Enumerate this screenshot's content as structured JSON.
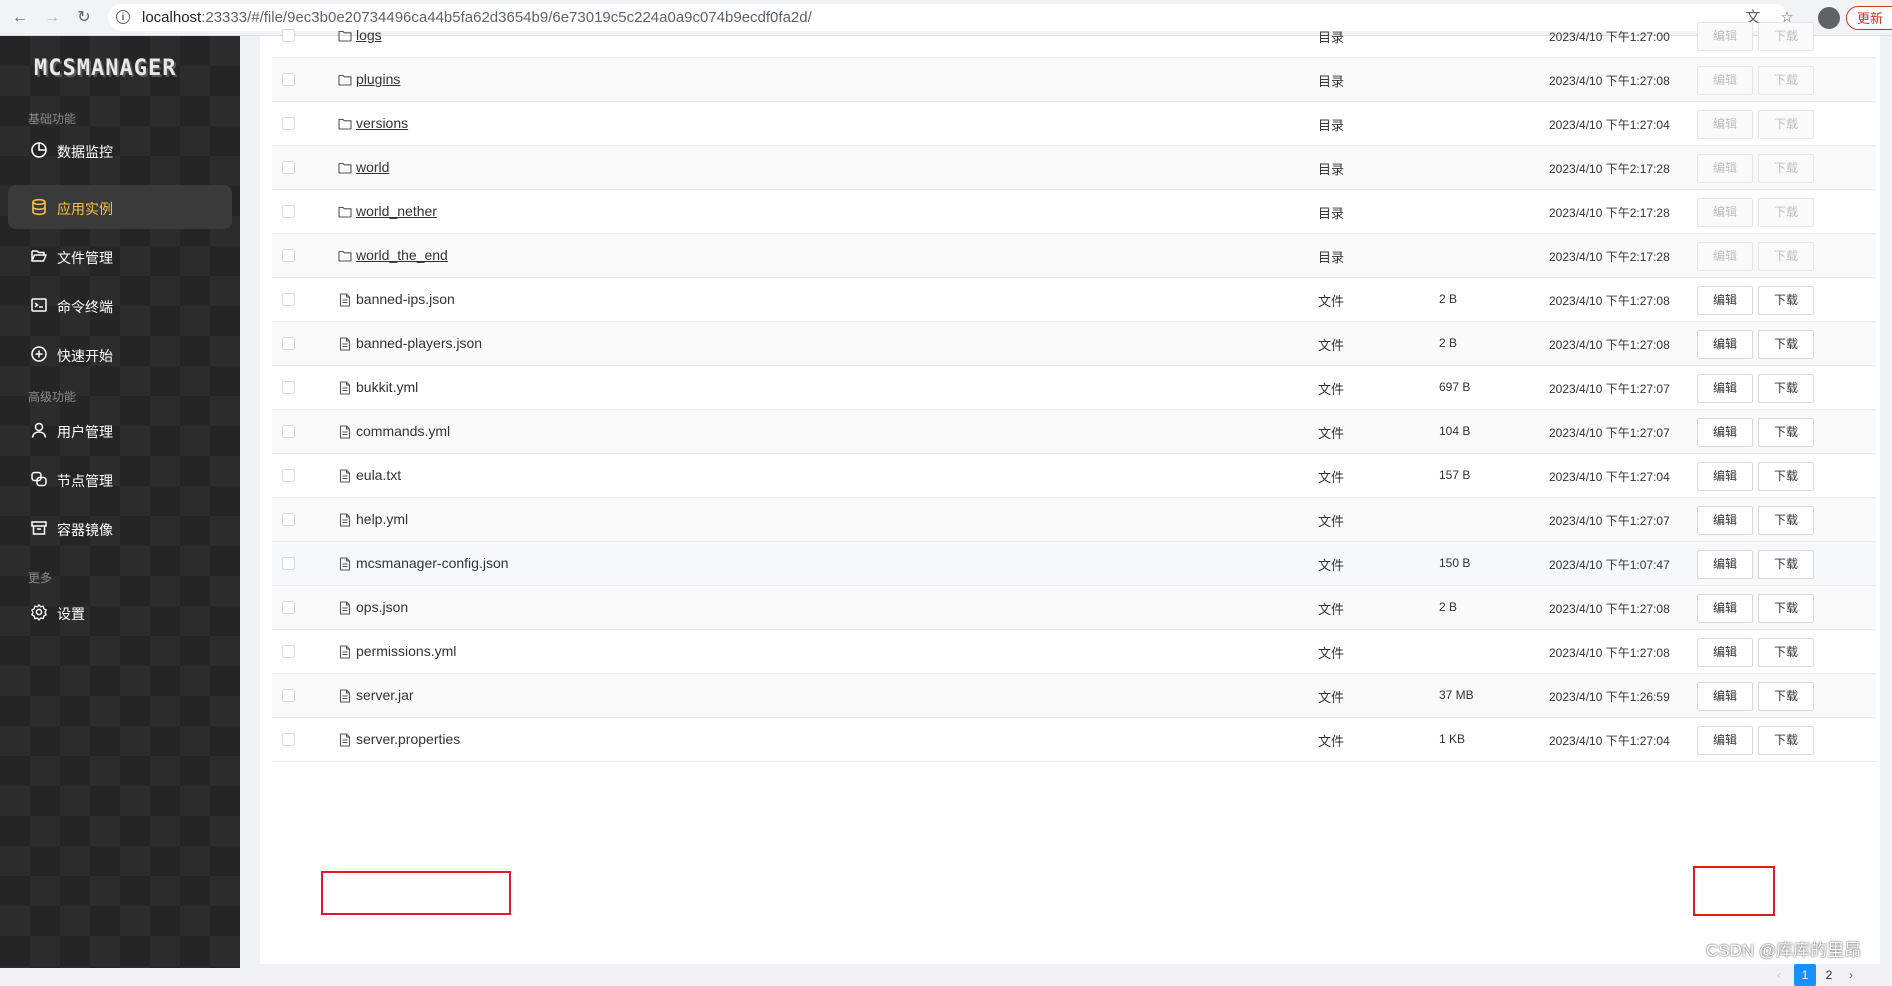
{
  "browser": {
    "url_host": "localhost",
    "url_rest": ":23333/#/file/9ec3b0e20734496ca44b5fa62d3654b9/6e73019c5c224a0a9c074b9ecdf0fa2d/",
    "update_label": "更新"
  },
  "sidebar": {
    "logo": "MCSMANAGER",
    "groups": [
      {
        "title": "基础功能"
      },
      {
        "title": "高级功能"
      },
      {
        "title": "更多"
      }
    ],
    "items": [
      {
        "label": "数据监控",
        "icon": "dashboard-icon"
      },
      {
        "label": "应用实例",
        "icon": "database-icon",
        "active": true
      },
      {
        "label": "文件管理",
        "icon": "folder-open-icon"
      },
      {
        "label": "命令终端",
        "icon": "terminal-icon"
      },
      {
        "label": "快速开始",
        "icon": "plus-circle-icon"
      },
      {
        "label": "用户管理",
        "icon": "user-icon"
      },
      {
        "label": "节点管理",
        "icon": "nodes-icon"
      },
      {
        "label": "容器镜像",
        "icon": "container-icon"
      },
      {
        "label": "设置",
        "icon": "gear-icon"
      }
    ]
  },
  "files": {
    "edit_label": "编辑",
    "download_label": "下载",
    "rows": [
      {
        "name": "logs",
        "type": "目录",
        "size": "",
        "date": "2023/4/10 下午1:27:00",
        "dir": true
      },
      {
        "name": "plugins",
        "type": "目录",
        "size": "",
        "date": "2023/4/10 下午1:27:08",
        "dir": true
      },
      {
        "name": "versions",
        "type": "目录",
        "size": "",
        "date": "2023/4/10 下午1:27:04",
        "dir": true
      },
      {
        "name": "world",
        "type": "目录",
        "size": "",
        "date": "2023/4/10 下午2:17:28",
        "dir": true
      },
      {
        "name": "world_nether",
        "type": "目录",
        "size": "",
        "date": "2023/4/10 下午2:17:28",
        "dir": true
      },
      {
        "name": "world_the_end",
        "type": "目录",
        "size": "",
        "date": "2023/4/10 下午2:17:28",
        "dir": true
      },
      {
        "name": "banned-ips.json",
        "type": "文件",
        "size": "2 B",
        "date": "2023/4/10 下午1:27:08",
        "dir": false
      },
      {
        "name": "banned-players.json",
        "type": "文件",
        "size": "2 B",
        "date": "2023/4/10 下午1:27:08",
        "dir": false
      },
      {
        "name": "bukkit.yml",
        "type": "文件",
        "size": "697 B",
        "date": "2023/4/10 下午1:27:07",
        "dir": false
      },
      {
        "name": "commands.yml",
        "type": "文件",
        "size": "104 B",
        "date": "2023/4/10 下午1:27:07",
        "dir": false
      },
      {
        "name": "eula.txt",
        "type": "文件",
        "size": "157 B",
        "date": "2023/4/10 下午1:27:04",
        "dir": false
      },
      {
        "name": "help.yml",
        "type": "文件",
        "size": "",
        "date": "2023/4/10 下午1:27:07",
        "dir": false
      },
      {
        "name": "mcsmanager-config.json",
        "type": "文件",
        "size": "150 B",
        "date": "2023/4/10 下午1:07:47",
        "dir": false
      },
      {
        "name": "ops.json",
        "type": "文件",
        "size": "2 B",
        "date": "2023/4/10 下午1:27:08",
        "dir": false
      },
      {
        "name": "permissions.yml",
        "type": "文件",
        "size": "",
        "date": "2023/4/10 下午1:27:08",
        "dir": false
      },
      {
        "name": "server.jar",
        "type": "文件",
        "size": "37 MB",
        "date": "2023/4/10 下午1:26:59",
        "dir": false
      },
      {
        "name": "server.properties",
        "type": "文件",
        "size": "1 KB",
        "date": "2023/4/10 下午1:27:04",
        "dir": false
      }
    ]
  },
  "pagination": {
    "prev": "‹",
    "pages": [
      "1",
      "2"
    ],
    "current": "1",
    "next": "›"
  },
  "watermark": "CSDN @库库的里昂",
  "colors": {
    "accent": "#f5c242",
    "highlight_box": "#e01b22",
    "page_active": "#1890ff"
  }
}
